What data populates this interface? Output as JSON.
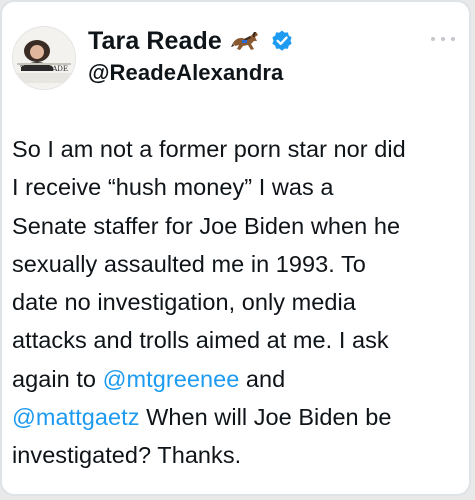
{
  "author": {
    "display_name": "Tara Reade",
    "handle": "@ReadeAlexandra",
    "avatar_text": "TARA READE",
    "emoji": "horse-emoji",
    "verified": true
  },
  "tweet": {
    "lines": [
      "So I am not a former porn star nor did",
      "I receive “hush money” I was a",
      "Senate staffer for Joe Biden when he",
      "sexually assaulted me in 1993. To",
      "date no investigation, only media",
      "attacks and trolls aimed at me. I ask",
      "again to ",
      " and",
      " When will Joe Biden be",
      "investigated? Thanks."
    ],
    "mentions": [
      "@mtgreenee",
      "@mattgaetz"
    ]
  },
  "colors": {
    "text": "#0f1419",
    "mention": "#1d9bf0",
    "verified": "#1d9bf0",
    "border": "#dfe3e6"
  }
}
